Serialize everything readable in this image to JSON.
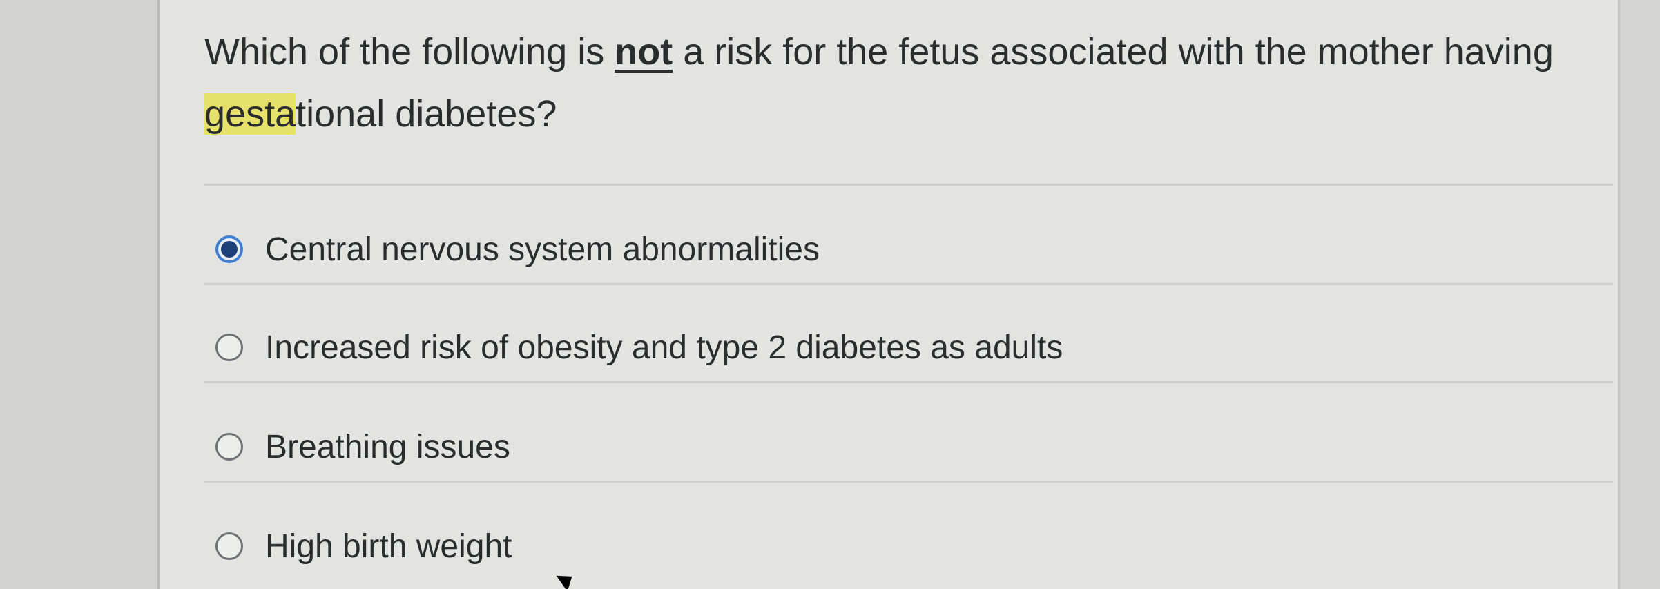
{
  "question": {
    "text_before": "Which of the following is ",
    "emphasis": "not",
    "text_middle": " a risk for the fetus associated with the mother having ",
    "highlight": "gesta",
    "text_after": "tional diabetes?"
  },
  "options": [
    {
      "label": "Central nervous system abnormalities",
      "selected": true
    },
    {
      "label": "Increased risk of obesity and type 2 diabetes as adults",
      "selected": false
    },
    {
      "label": "Breathing issues",
      "selected": false
    },
    {
      "label": "High birth weight",
      "selected": false
    }
  ],
  "colors": {
    "highlight": "#e5e16a",
    "selected_ring": "#3f7fd2",
    "selected_dot": "#1d3f78"
  }
}
